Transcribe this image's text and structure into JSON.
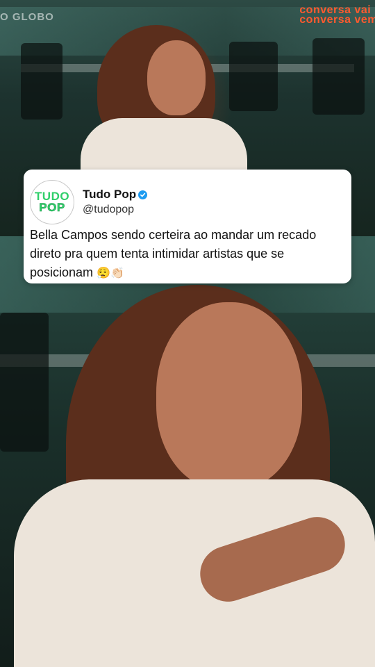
{
  "video": {
    "channel_logo": "O GLOBO",
    "watermark_lines": [
      "conversa vai",
      "conversa vem"
    ]
  },
  "tweet": {
    "avatar_lines": [
      "TUDO",
      "POP"
    ],
    "display_name": "Tudo Pop",
    "handle": "@tudopop",
    "text": "Bella Campos sendo certeira ao mandar um recado direto pra quem tenta intimidar artistas que se posicionam",
    "emojis": "😮‍💨👏🏻",
    "verified": true,
    "accent_color": "#1d9bf0",
    "avatar_color": "#2fcf6a"
  }
}
